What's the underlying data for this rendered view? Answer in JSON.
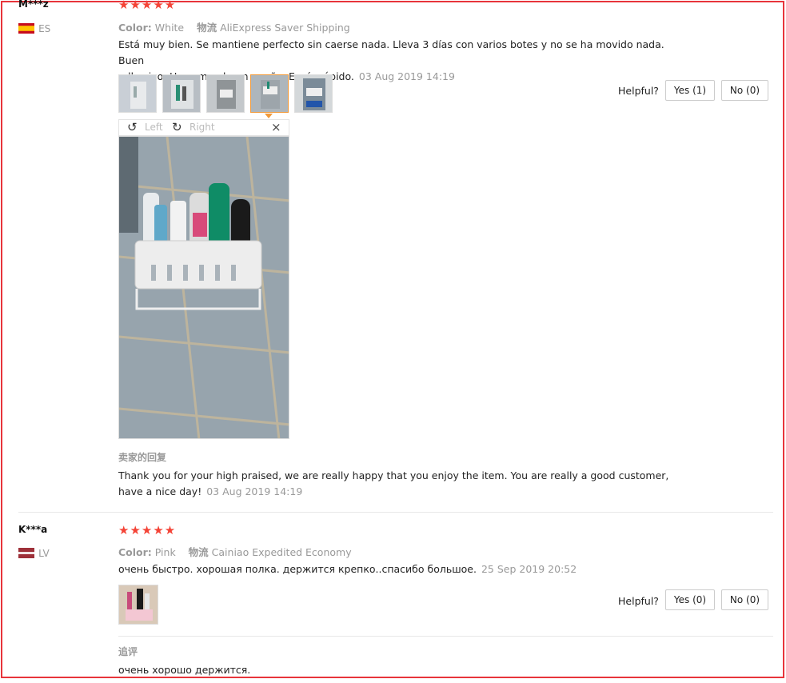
{
  "reviews": [
    {
      "user": "M***z",
      "country": "ES",
      "rating_stars": "★★★★★",
      "color_label": "Color:",
      "color_value": "White",
      "shipping_label": "物流",
      "shipping_value": "AliExpress Saver Shipping",
      "text_line1": "Está muy bien. Se mantiene perfecto sin caerse nada. Lleva 3 días con varios botes y no se ha movido nada. Buen",
      "text_line2": "adhesivo. Hace muy buen apaño. Envío rápido.",
      "date": "03 Aug 2019 14:19",
      "helpful_label": "Helpful?",
      "yes_label": "Yes (1)",
      "no_label": "No (0)",
      "viewer": {
        "rotate_left": "Left",
        "rotate_right": "Right",
        "close": "×"
      },
      "reply_label": "卖家的回复",
      "reply_line1": "Thank you for your high praised, we are really happy that you enjoy the item. You are really a good customer,",
      "reply_line2": "have a nice day!",
      "reply_date": "03 Aug 2019 14:19"
    },
    {
      "user": "K***a",
      "country": "LV",
      "rating_stars": "★★★★★",
      "color_label": "Color:",
      "color_value": "Pink",
      "shipping_label": "物流",
      "shipping_value": "Cainiao Expedited Economy",
      "text_line1": "очень быстро. хорошая полка. держится крепко..спасибо большое.",
      "date": "25 Sep 2019 20:52",
      "helpful_label": "Helpful?",
      "yes_label": "Yes (0)",
      "no_label": "No (0)",
      "followup_label": "追评",
      "followup_text": "очень хорошо держится."
    }
  ],
  "colors": {
    "accent_red": "#e8353b",
    "star_red": "#f44336",
    "selected_thumb": "#f29a3a",
    "muted_text": "#999999"
  }
}
